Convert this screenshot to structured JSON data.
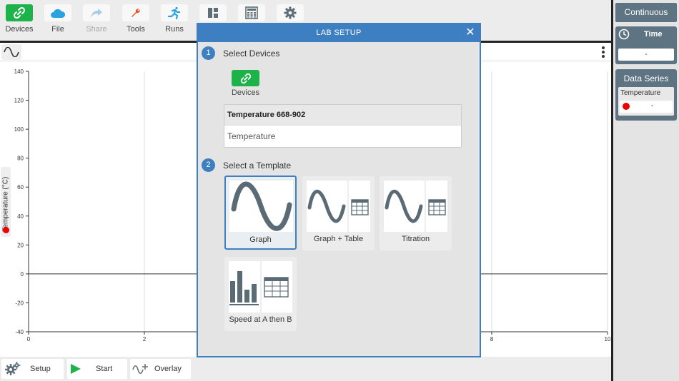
{
  "toolbar": {
    "items": [
      {
        "label": "Devices",
        "icon": "link-icon"
      },
      {
        "label": "File",
        "icon": "cloud-icon"
      },
      {
        "label": "Share",
        "icon": "share-icon"
      },
      {
        "label": "Tools",
        "icon": "wrench-icon"
      },
      {
        "label": "Runs",
        "icon": "runner-icon"
      },
      {
        "label": "",
        "icon": "layout-icon"
      },
      {
        "label": "",
        "icon": "calculator-icon"
      },
      {
        "label": "",
        "icon": "gear-icon"
      }
    ]
  },
  "graph": {
    "y_axis_label": "Temperature (°C)",
    "y_ticks": [
      "140",
      "120",
      "100",
      "80",
      "60",
      "40",
      "20",
      "0",
      "-20",
      "-40"
    ],
    "x_ticks": [
      "0",
      "2",
      "8",
      "10"
    ]
  },
  "bottom": {
    "setup_label": "Setup",
    "start_label": "Start",
    "overlay_label": "Overlay"
  },
  "right_panel": {
    "mode": "Continuous",
    "time_label": "Time",
    "time_value": "-",
    "data_series_title": "Data Series",
    "series": [
      {
        "name": "Temperature",
        "value": "-",
        "color": "#e00000"
      }
    ]
  },
  "modal": {
    "title": "LAB SETUP",
    "close": "✕",
    "step1_num": "1",
    "step1_label": "Select Devices",
    "devices_label": "Devices",
    "sensor_name": "Temperature 668-902",
    "sensor_channel": "Temperature",
    "step2_num": "2",
    "step2_label": "Select a Template",
    "templates": [
      {
        "label": "Graph",
        "selected": true
      },
      {
        "label": "Graph + Table",
        "selected": false
      },
      {
        "label": "Titration",
        "selected": false
      },
      {
        "label": "Speed at A then B",
        "selected": false
      }
    ]
  },
  "colors": {
    "accent": "#3d7fc1",
    "green": "#1db34a",
    "panel": "#5e7482"
  }
}
